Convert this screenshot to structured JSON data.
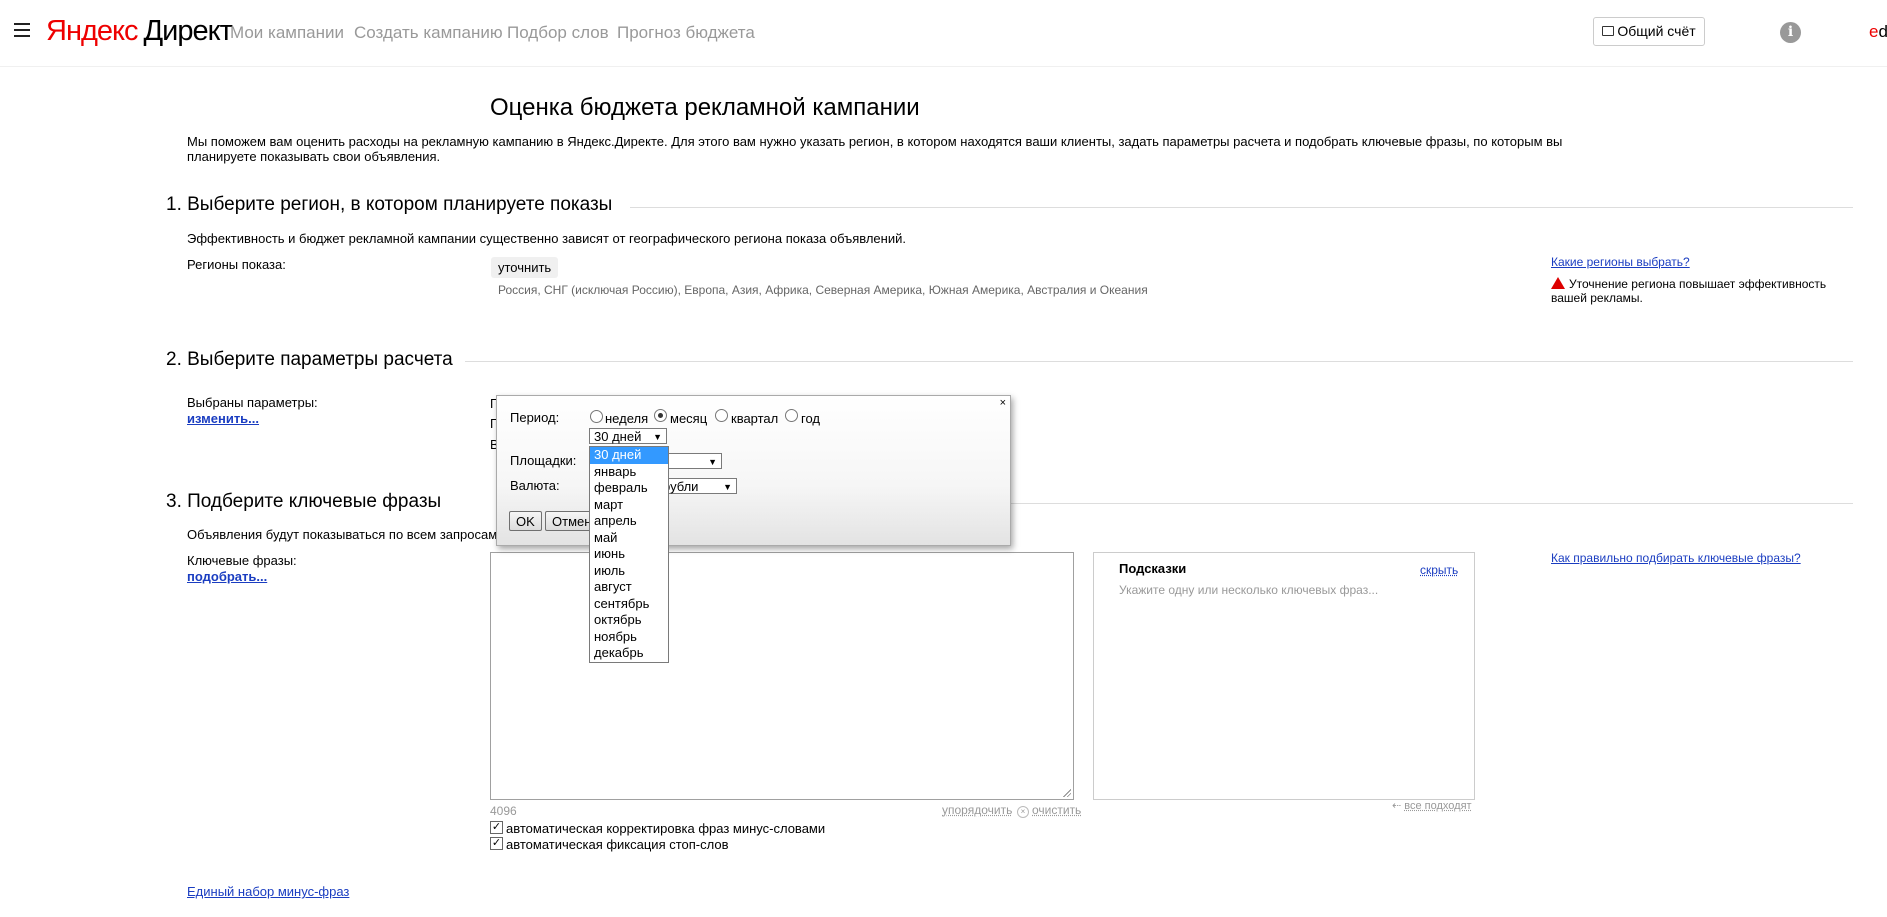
{
  "header": {
    "logo_brand": "Яндекс",
    "logo_product": "Директ",
    "nav": [
      "Мои кампании",
      "Создать кампанию",
      "Подбор слов",
      "Прогноз бюджета"
    ],
    "account_button": "Общий счёт",
    "info_icon": "i",
    "user": "ed"
  },
  "page": {
    "title": "Оценка бюджета рекламной кампании",
    "intro_line1": "Мы поможем вам оценить расходы на рекламную кампанию в Яндекс.Директе. Для этого вам нужно указать регион, в котором находятся ваши клиенты, задать параметры расчета и подобрать ключевые фразы, по которым вы",
    "intro_line2": "планируете показывать свои объявления."
  },
  "section1": {
    "title": "1. Выберите регион, в котором планируете показы",
    "description": "Эффективность и бюджет рекламной кампании существенно зависят от географического региона показа объявлений.",
    "regions_label": "Регионы показа:",
    "refine_chip": "уточнить",
    "regions_value": "Россия, СНГ (исключая Россию), Европа, Азия, Африка, Северная Америка, Южная Америка, Австралия и Океания",
    "help_link": "Какие регионы выбрать?",
    "warning_text": "Уточнение региона повышает эффективность вашей рекламы."
  },
  "section2": {
    "title": "2. Выберите параметры расчета",
    "params_label": "Выбраны параметры:",
    "change_link": "изменить...",
    "hidden_initials": [
      "П",
      "П",
      "В"
    ]
  },
  "section3": {
    "title": "3. Подберите ключевые фразы",
    "description": "Объявления будут показываться по всем запросам,",
    "keywords_label": "Ключевые фразы:",
    "pick_link": "подобрать...",
    "char_count": "4096",
    "sort_link": "упорядочить",
    "clear_link": "очистить",
    "hints_title": "Подсказки",
    "hints_hide": "скрыть",
    "hints_placeholder": "Укажите одну или несколько ключевых фраз...",
    "all_fit": "все подходят",
    "help_link": "Как правильно подбирать ключевые фразы?",
    "checkbox1": "автоматическая корректировка фраз минус-словами",
    "checkbox2": "автоматическая фиксация стоп-слов",
    "minus_link": "Единый набор минус-фраз"
  },
  "dialog": {
    "period_label": "Период:",
    "period_options": [
      "неделя",
      "месяц",
      "квартал",
      "год"
    ],
    "period_selected": "месяц",
    "period_select_value": "30 дней",
    "platforms_label": "Площадки:",
    "currency_label": "Валюта:",
    "currency_value": "рубли",
    "ok": "OK",
    "cancel": "Отмена",
    "close": "×",
    "dropdown_options": [
      "30 дней",
      "январь",
      "февраль",
      "март",
      "апрель",
      "май",
      "июнь",
      "июль",
      "август",
      "сентябрь",
      "октябрь",
      "ноябрь",
      "декабрь"
    ],
    "dropdown_selected": "30 дней"
  }
}
